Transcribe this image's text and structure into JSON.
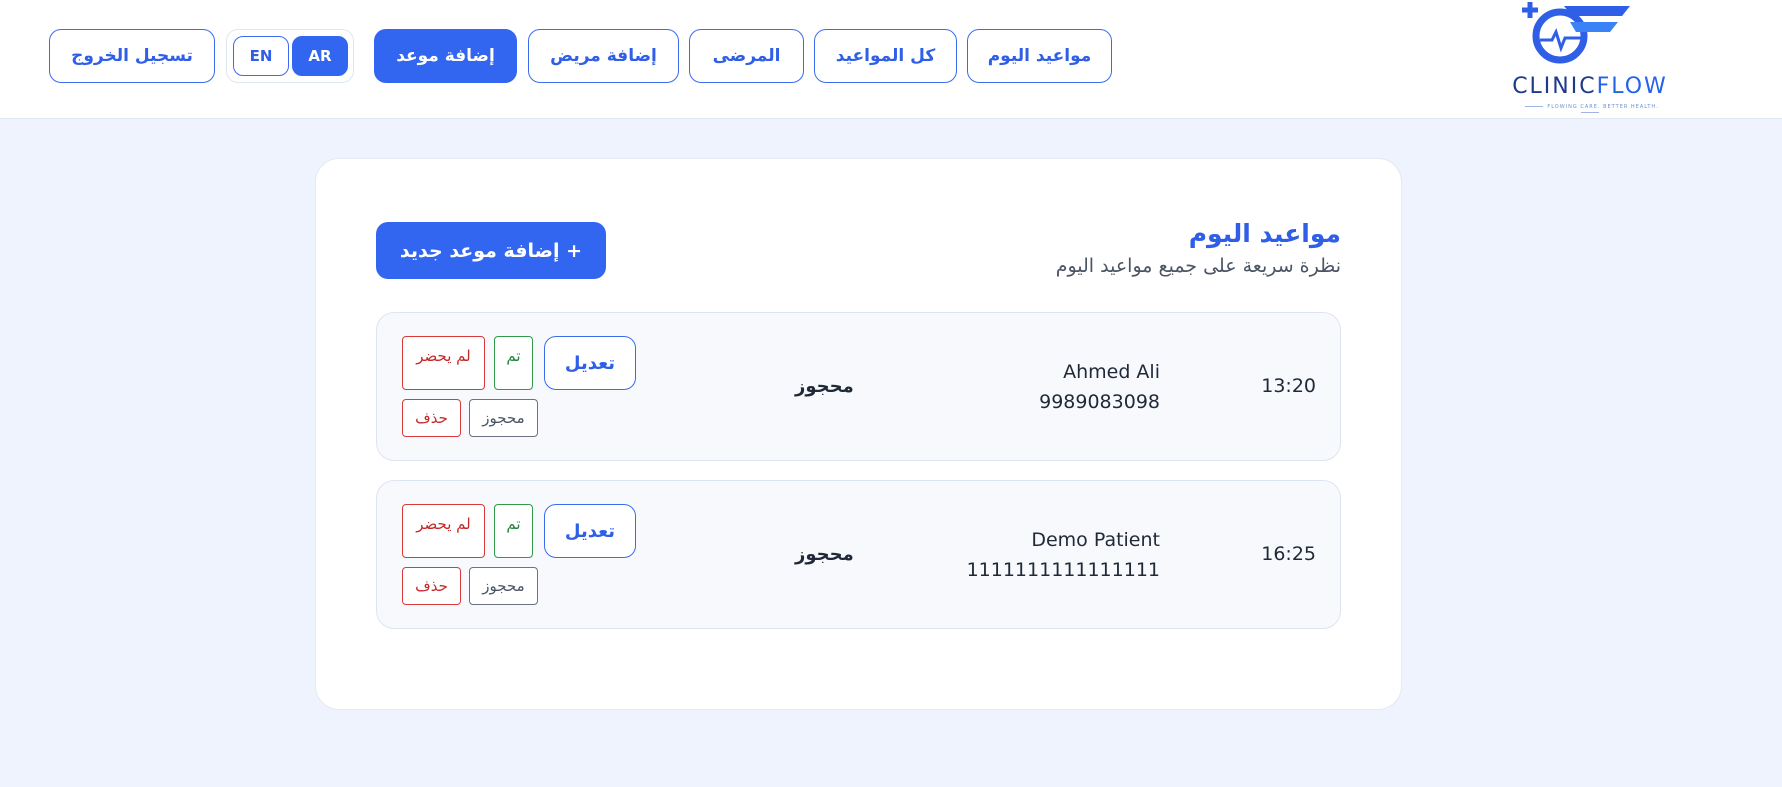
{
  "brand": {
    "logo_word_a": "CLINIC",
    "logo_word_b": "FLOW",
    "tagline": "FLOWING CARE. BETTER HEALTH."
  },
  "nav": {
    "today": "مواعيد اليوم",
    "all": "كل المواعيد",
    "patients": "المرضى",
    "add_patient": "إضافة مريض",
    "add_appointment": "إضافة موعد",
    "lang_ar": "AR",
    "lang_en": "EN",
    "logout": "تسجيل الخروج"
  },
  "page": {
    "title": "مواعيد اليوم",
    "subtitle": "نظرة سريعة على جميع مواعيد اليوم",
    "add_new": "+ إضافة موعد جديد"
  },
  "actions": {
    "edit": "تعديل",
    "done": "تم",
    "no_show": "لم يحضر",
    "booked": "محجوز",
    "delete": "حذف"
  },
  "appointments": [
    {
      "time": "13:20",
      "name": "Ahmed Ali",
      "phone": "9989083098",
      "status": "محجوز"
    },
    {
      "time": "16:25",
      "name": "Demo Patient",
      "phone": "1111111111111111",
      "status": "محجوز"
    }
  ],
  "colors": {
    "primary": "#3366f0",
    "success": "#22863a",
    "danger": "#c62828",
    "background": "#eef3fd"
  }
}
